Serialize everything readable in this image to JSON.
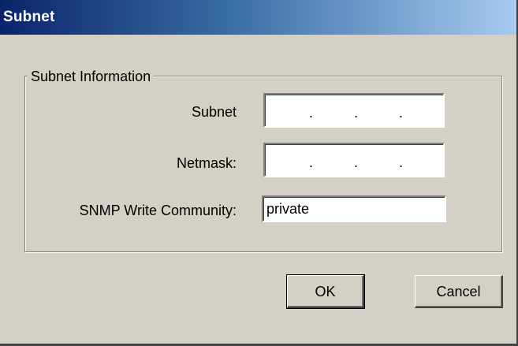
{
  "window": {
    "title": "Subnet"
  },
  "group": {
    "legend": "Subnet Information"
  },
  "fields": {
    "subnet_label": "Subnet",
    "subnet_value": [
      "",
      "",
      "",
      ""
    ],
    "netmask_label": "Netmask:",
    "netmask_value": [
      "",
      "",
      "",
      ""
    ],
    "community_label": "SNMP Write Community:",
    "community_value": "private"
  },
  "ip_separator": ".",
  "buttons": {
    "ok_label": "OK",
    "cancel_label": "Cancel"
  },
  "colors": {
    "dialog_face": "#d4d0c8",
    "title_gradient_start": "#0a246a",
    "title_gradient_end": "#a6caf0",
    "title_text": "#ffffff"
  }
}
